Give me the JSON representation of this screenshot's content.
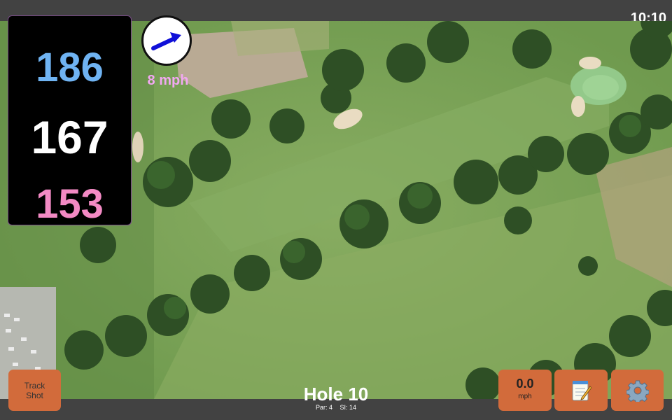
{
  "status": {
    "time": "10:10"
  },
  "distances": {
    "back": "186",
    "middle": "167",
    "front": "153"
  },
  "wind": {
    "speed_label": "8 mph",
    "icon": "arrow-icon",
    "arrow_color": "#1010d8"
  },
  "hole": {
    "title": "Hole 10",
    "par": "Par: 4",
    "si": "SI: 14"
  },
  "buttons": {
    "track_shot": [
      "Track",
      "Shot"
    ],
    "speed_value": "0.0",
    "speed_unit": "mph",
    "notes_icon": "notepad-icon",
    "settings_icon": "gear-icon"
  },
  "colors": {
    "accent": "#d26b3b",
    "back_distance": "#6fb3f2",
    "middle_distance": "#ffffff",
    "front_distance": "#f38ac4",
    "wind_text": "#f2a8f2"
  }
}
